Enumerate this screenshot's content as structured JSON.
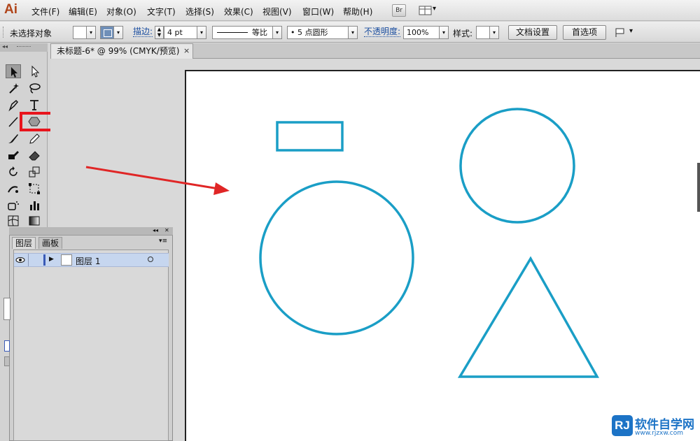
{
  "app": {
    "logo": "Ai"
  },
  "menu": [
    "文件(F)",
    "编辑(E)",
    "对象(O)",
    "文字(T)",
    "选择(S)",
    "效果(C)",
    "视图(V)",
    "窗口(W)",
    "帮助(H)"
  ],
  "menu_buttons": {
    "bridge": "Br",
    "arrange_arrow": "▾"
  },
  "control_bar": {
    "selection_status": "未选择对象",
    "stroke_link": "描边:",
    "stroke_weight": "4 pt",
    "stroke_profile": "等比",
    "brush": "• 5 点圆形",
    "opacity_link": "不透明度:",
    "opacity_value": "100%",
    "style_label": "样式:",
    "doc_setup_button": "文档设置",
    "preferences_button": "首选项",
    "dropdown_arrow": "▾"
  },
  "document_tab": {
    "title": "未标题-6* @ 99% (CMYK/预览)",
    "close": "×"
  },
  "layers_panel": {
    "tabs": [
      "图层",
      "画板"
    ],
    "layer_name": "图层 1",
    "collapse": "◂◂",
    "close": "✕",
    "menu": "▾≡"
  },
  "watermark": {
    "logo": "RJ",
    "name": "软件自学网",
    "url": "www.rjzxw.com"
  },
  "colors": {
    "shape_stroke": "#1a9ec6",
    "highlight_box": "#e8141c",
    "arrow": "#e02626",
    "layer_highlight": "#c6d6ef",
    "watermark": "#1c73c6"
  },
  "icons": {
    "selection": "selection-tool-icon",
    "direct_selection": "direct-selection-tool-icon",
    "magic_wand": "magic-wand-tool-icon",
    "lasso": "lasso-tool-icon",
    "pen": "pen-tool-icon",
    "type": "type-tool-icon",
    "line": "line-tool-icon",
    "shape": "polygon-tool-icon",
    "paintbrush": "paintbrush-tool-icon",
    "pencil": "pencil-tool-icon",
    "blob_brush": "blob-brush-tool-icon",
    "eraser": "eraser-tool-icon",
    "rotate": "rotate-tool-icon",
    "scale": "scale-tool-icon",
    "warp": "warp-tool-icon",
    "free_transform": "free-transform-tool-icon",
    "symbol_sprayer": "symbol-sprayer-tool-icon",
    "column_graph": "column-graph-tool-icon",
    "mesh": "mesh-tool-icon",
    "gradient": "gradient-tool-icon"
  }
}
